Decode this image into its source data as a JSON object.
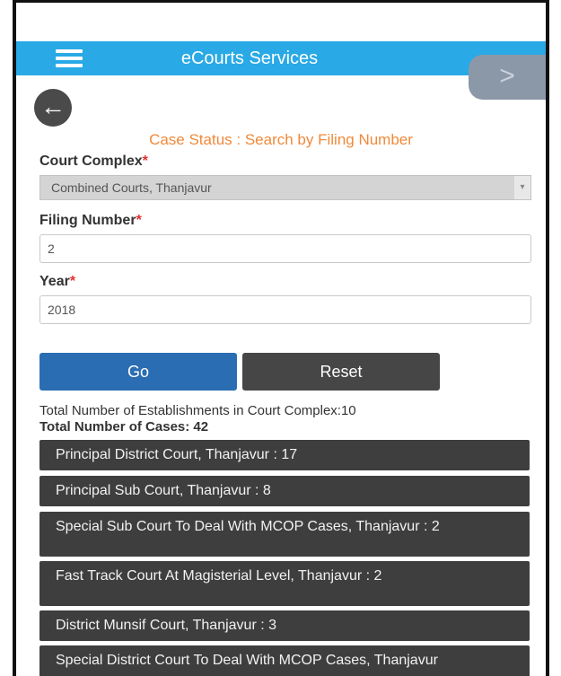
{
  "header": {
    "app_title": "eCourts Services",
    "menu_icon": "hamburger-menu-icon",
    "next_icon": "chevron-right-icon",
    "next_glyph": ">",
    "back_icon": "arrow-left-icon",
    "back_glyph": "←",
    "bar_color": "#29a9e6"
  },
  "form": {
    "section_title": "Case Status : Search by Filing Number",
    "court_complex_label": "Court Complex",
    "court_complex_value": "Combined Courts, Thanjavur",
    "filing_number_label": "Filing Number",
    "filing_number_value": "2",
    "year_label": "Year",
    "year_value": "2018",
    "required_mark": "*"
  },
  "actions": {
    "go_label": "Go",
    "reset_label": "Reset"
  },
  "results": {
    "establishments_text": "Total Number of Establishments in Court Complex:10",
    "cases_text": "Total Number of Cases: 42",
    "items": [
      {
        "label": "Principal District Court, Thanjavur : 17"
      },
      {
        "label": "Principal Sub Court, Thanjavur : 8"
      },
      {
        "label": "Special Sub Court To Deal With MCOP Cases, Thanjavur : 2"
      },
      {
        "label": "Fast Track Court At Magisterial Level, Thanjavur : 2"
      },
      {
        "label": "District Munsif Court, Thanjavur : 3"
      },
      {
        "label": "Special District Court To Deal With MCOP Cases, Thanjavur"
      }
    ]
  }
}
